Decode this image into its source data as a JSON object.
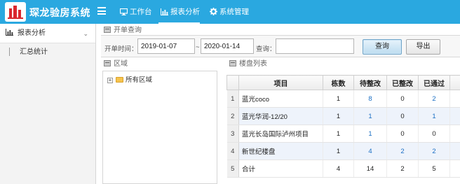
{
  "app": {
    "title": "琛龙验房系统"
  },
  "nav": [
    {
      "label": "工作台",
      "icon": "monitor-icon"
    },
    {
      "label": "报表分析",
      "icon": "bar-chart-icon",
      "active": true
    },
    {
      "label": "系统管理",
      "icon": "gear-icon"
    }
  ],
  "sidebar": {
    "section": {
      "label": "报表分析",
      "icon": "bar-chart-icon"
    },
    "items": [
      {
        "label": "汇总统计"
      }
    ]
  },
  "query": {
    "panel_title": "开单查询",
    "time_label": "开单时间：",
    "start_date": "2019-01-07",
    "range_sep": "~",
    "end_date": "2020-01-14",
    "search_label": "查询：",
    "search_value": "",
    "query_button": "查询",
    "export_button": "导出"
  },
  "region": {
    "panel_title": "区域",
    "tree": [
      {
        "label": "所有区域"
      }
    ]
  },
  "table": {
    "panel_title": "楼盘列表",
    "columns": [
      "",
      "项目",
      "栋数",
      "待整改",
      "已整改",
      "已通过"
    ],
    "rows": [
      {
        "no": "1",
        "project": "蓝光coco",
        "buildings": "1",
        "pending": "8",
        "fixed": "0",
        "passed": "2"
      },
      {
        "no": "2",
        "project": "蓝光华润-12/20",
        "buildings": "1",
        "pending": "1",
        "fixed": "0",
        "passed": "1"
      },
      {
        "no": "3",
        "project": "蓝光长岛国际泸州项目",
        "buildings": "1",
        "pending": "1",
        "fixed": "0",
        "passed": "0"
      },
      {
        "no": "4",
        "project": "新世纪楼盘",
        "buildings": "1",
        "pending": "4",
        "fixed": "2",
        "passed": "2"
      },
      {
        "no": "5",
        "project": "合计",
        "buildings": "4",
        "pending": "14",
        "fixed": "2",
        "passed": "5"
      }
    ]
  },
  "colors": {
    "header": "#2aa8e0",
    "link": "#1a6fc4",
    "logo": "#d9272e"
  }
}
